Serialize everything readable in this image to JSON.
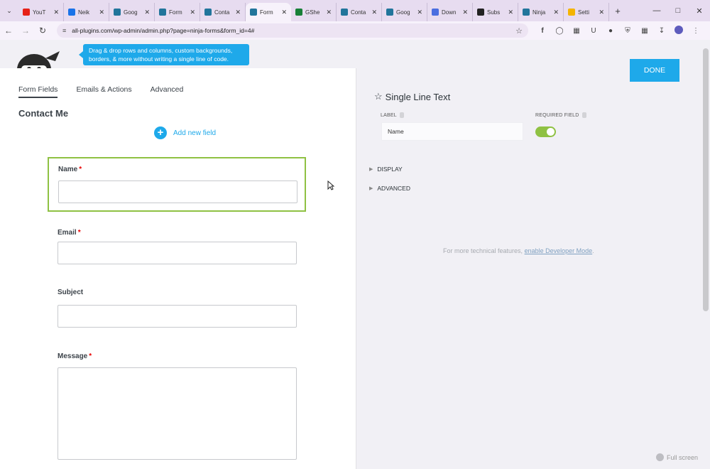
{
  "browser": {
    "tabs": [
      {
        "title": "YouT",
        "icon": "youtube-icon",
        "color": "#e62117"
      },
      {
        "title": "Neik",
        "icon": "mail-icon",
        "color": "#1a73e8"
      },
      {
        "title": "Goog",
        "icon": "wordpress-icon",
        "color": "#21759b"
      },
      {
        "title": "Form",
        "icon": "wordpress-icon",
        "color": "#21759b"
      },
      {
        "title": "Conta",
        "icon": "wordpress-icon",
        "color": "#21759b"
      },
      {
        "title": "Form",
        "icon": "wordpress-icon",
        "color": "#21759b",
        "active": true
      },
      {
        "title": "GShe",
        "icon": "sheets-icon",
        "color": "#188038"
      },
      {
        "title": "Conta",
        "icon": "wordpress-icon",
        "color": "#21759b"
      },
      {
        "title": "Goog",
        "icon": "wordpress-icon",
        "color": "#21759b"
      },
      {
        "title": "Down",
        "icon": "download-icon",
        "color": "#4a6ee0"
      },
      {
        "title": "Subs",
        "icon": "github-icon",
        "color": "#222222"
      },
      {
        "title": "Ninja",
        "icon": "wordpress-icon",
        "color": "#21759b"
      },
      {
        "title": "Setti",
        "icon": "drive-icon",
        "color": "#f4b400"
      }
    ],
    "url": "all-plugins.com/wp-admin/admin.php?page=ninja-forms&form_id=4#"
  },
  "tooltip": "Drag & drop rows and columns, custom backgrounds, borders, & more without writing a single line of code.",
  "builder": {
    "tabs": [
      "Form Fields",
      "Emails & Actions",
      "Advanced"
    ],
    "form_title": "Contact Me",
    "add_field_label": "Add new field",
    "fields": [
      {
        "label": "Name",
        "required_mark": "*"
      },
      {
        "label": "Email",
        "required_mark": "*"
      },
      {
        "label": "Subject",
        "required_mark": ""
      },
      {
        "label": "Message",
        "required_mark": "*"
      }
    ]
  },
  "settings": {
    "done_label": "DONE",
    "field_type": "Single Line Text",
    "label_heading": "LABEL",
    "label_value": "Name",
    "required_heading": "REQUIRED FIELD",
    "required_on": true,
    "sections": [
      "DISPLAY",
      "ADVANCED"
    ],
    "dev_note_prefix": "For more technical features,",
    "dev_note_link": "enable Developer Mode",
    "dev_note_suffix": "."
  },
  "fullscreen_label": "Full screen",
  "colors": {
    "accent": "#1ea9ea",
    "selected_border": "#8fc143",
    "required": "#e80000"
  }
}
